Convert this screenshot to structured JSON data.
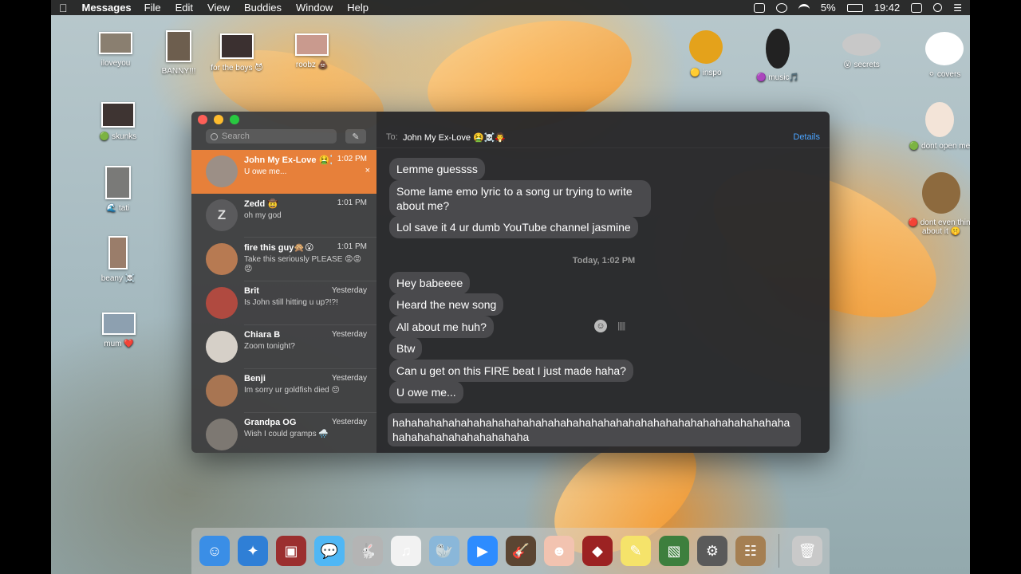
{
  "menubar": {
    "app_name": "Messages",
    "menus": [
      "File",
      "Edit",
      "View",
      "Buddies",
      "Window",
      "Help"
    ],
    "battery": "5%",
    "time": "19:42"
  },
  "desktop_icons": [
    {
      "label": "iloveyou",
      "icon": "photo-thumbnail",
      "color": "#8a7f70"
    },
    {
      "label": "BANNY!!!",
      "icon": "photo-thumbnail",
      "color": "#6d5e4e"
    },
    {
      "label": "for the boys 😈",
      "icon": "photo-thumbnail",
      "color": "#3b3030"
    },
    {
      "label": "roobz 💩",
      "icon": "photo-thumbnail",
      "color": "#c99a8e"
    },
    {
      "label": "🟡 inspo",
      "icon": "sunflower-icon",
      "color": "#e4a21b"
    },
    {
      "label": "🟣 music🎵",
      "icon": "treble-clef-icon",
      "color": "#222222"
    },
    {
      "label": "😮 secrets",
      "icon": "key-icon",
      "color": "#c8c8c8"
    },
    {
      "label": "⚪ covers",
      "icon": "bunny-icon",
      "color": "#ffffff"
    },
    {
      "label": "🟢 skunks",
      "icon": "photo-thumbnail",
      "color": "#3e3432"
    },
    {
      "label": "🌊 tati",
      "icon": "photo-thumbnail",
      "color": "#7a7a78"
    },
    {
      "label": "beany ☠️",
      "icon": "photo-thumbnail",
      "color": "#9a7d6a"
    },
    {
      "label": "mum ❤️",
      "icon": "photo-thumbnail",
      "color": "#8da0b0"
    },
    {
      "label": "🟢 dont open me",
      "icon": "bunny-icon",
      "color": "#f3e4d8"
    },
    {
      "label": "🔴 dont even think about it 🤫",
      "icon": "lion-icon",
      "color": "#8d6a3e"
    }
  ],
  "sidebar": {
    "search_placeholder": "Search",
    "conversations": [
      {
        "name": "John My Ex-Love 🤮☠️",
        "time": "1:02 PM",
        "preview": "U owe me...",
        "selected": true,
        "avatar_color": "#9c8f86",
        "initial": ""
      },
      {
        "name": "Zedd 🤠",
        "time": "1:01 PM",
        "preview": "oh my god",
        "selected": false,
        "avatar_color": "#5a5a5c",
        "initial": "Z"
      },
      {
        "name": "fire this guy🙊😮",
        "time": "1:01 PM",
        "preview": "Take this seriously PLEASE 😡😡😡",
        "selected": false,
        "avatar_color": "#b77a52",
        "initial": ""
      },
      {
        "name": "Brit",
        "time": "Yesterday",
        "preview": "Is John still hitting u up?!?!",
        "selected": false,
        "avatar_color": "#b04a40",
        "initial": ""
      },
      {
        "name": "Chiara B",
        "time": "Yesterday",
        "preview": "Zoom tonight?",
        "selected": false,
        "avatar_color": "#d6d0c8",
        "initial": ""
      },
      {
        "name": "Benji",
        "time": "Yesterday",
        "preview": "Im sorry ur goldfish died 😔",
        "selected": false,
        "avatar_color": "#a87552",
        "initial": ""
      },
      {
        "name": "Grandpa OG",
        "time": "Yesterday",
        "preview": "Wish I could gramps 🌧️",
        "selected": false,
        "avatar_color": "#7d7872",
        "initial": ""
      }
    ]
  },
  "chat": {
    "to_label": "To:",
    "recipient": "John My Ex-Love 🤮☠️🧛",
    "details": "Details",
    "messages": [
      {
        "text": "Lemme guessss"
      },
      {
        "text": "Some lame emo lyric to a song ur trying to write about me?"
      },
      {
        "text": "Lol save it 4 ur dumb YouTube channel jasmine"
      }
    ],
    "timestamp": "Today, 1:02 PM",
    "messages_after": [
      {
        "text": "Hey babeeee"
      },
      {
        "text": "Heard the new song"
      },
      {
        "text": "All about me huh?"
      },
      {
        "text": "Btw"
      },
      {
        "text": "Can u get on this FIRE beat I just made haha?"
      },
      {
        "text": "U owe me..."
      }
    ],
    "input_value": "hahahahahahahahahahahahahahahahahahahahahahahahahahahahahahahahahahahahahahahahahahaha"
  },
  "dock": [
    {
      "name": "finder-icon",
      "glyph": "☺",
      "color": "#3a8ee6"
    },
    {
      "name": "safari-icon",
      "glyph": "✦",
      "color": "#2f7fd6"
    },
    {
      "name": "photo-booth-icon",
      "glyph": "▣",
      "color": "#9b2f2f"
    },
    {
      "name": "messages-icon",
      "glyph": "💬",
      "color": "#4fb7f5"
    },
    {
      "name": "rabbit-icon",
      "glyph": "🐇",
      "color": "#b4b4b4"
    },
    {
      "name": "itunes-icon",
      "glyph": "♫",
      "color": "#f2f2f2"
    },
    {
      "name": "seal-icon",
      "glyph": "🦭",
      "color": "#8ab7d9"
    },
    {
      "name": "zoom-icon",
      "glyph": "▶",
      "color": "#2d8cff"
    },
    {
      "name": "garageband-icon",
      "glyph": "🎸",
      "color": "#5b4532"
    },
    {
      "name": "face-icon",
      "glyph": "☻",
      "color": "#f2c3b0"
    },
    {
      "name": "photo-icon",
      "glyph": "◆",
      "color": "#9c2222"
    },
    {
      "name": "stickies-icon",
      "glyph": "✎",
      "color": "#f5e36a"
    },
    {
      "name": "preview-icon",
      "glyph": "▧",
      "color": "#3d7f3d"
    },
    {
      "name": "system-preferences-icon",
      "glyph": "⚙",
      "color": "#5a5a5a"
    },
    {
      "name": "contacts-icon",
      "glyph": "☷",
      "color": "#a57f52"
    },
    {
      "name": "trash-icon",
      "glyph": "🗑",
      "color": "#c9c9c9"
    }
  ]
}
